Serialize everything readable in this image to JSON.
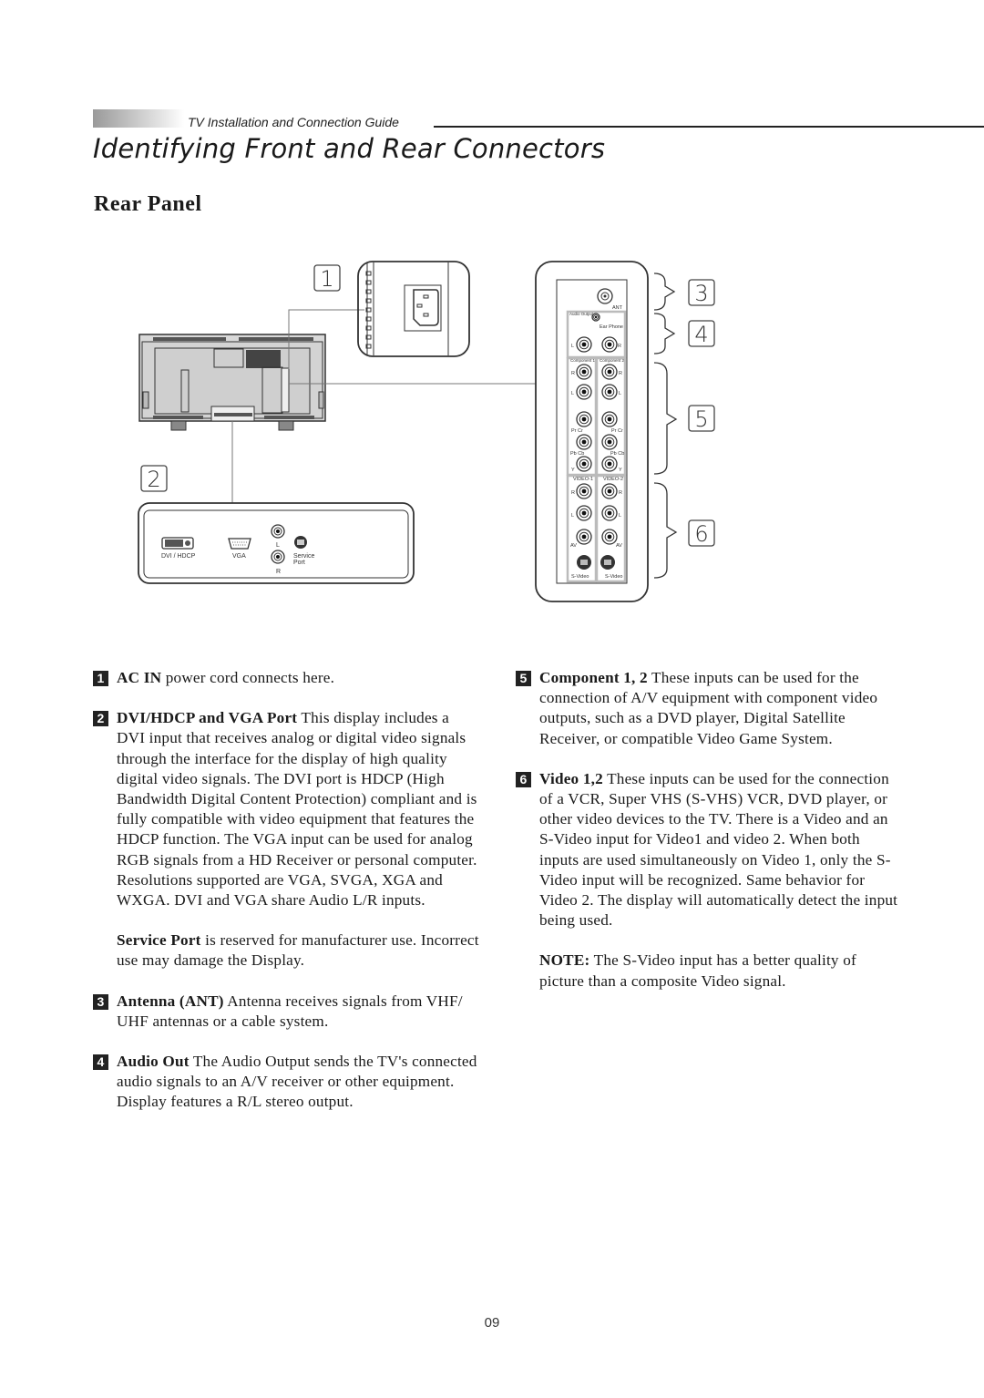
{
  "header": {
    "guide_title": "TV Installation and Connection Guide",
    "page_title": "Identifying Front and Rear Connectors",
    "section_title": "Rear Panel"
  },
  "diagram": {
    "callouts": [
      "1",
      "2",
      "3",
      "4",
      "5",
      "6"
    ],
    "bottom_panel_labels": {
      "dvi": "DVI / HDCP",
      "vga": "VGA",
      "audio_l": "L",
      "audio_r": "R",
      "service_line1": "Service",
      "service_line2": "Port"
    },
    "side_panel_labels": {
      "ant": "ANT",
      "audio_output": "Audio Output",
      "ear_phone": "Ear Phone",
      "L": "L",
      "R": "R",
      "component1": "Component 1",
      "component2": "Component 2",
      "pr_cr": "Pr  Cr",
      "pb_cb": "Pb  Cb",
      "Y": "Y",
      "video1": "VIDEO-1",
      "video2": "VIDEO-2",
      "av": "AV",
      "svideo": "S-Video"
    }
  },
  "left_column": {
    "items": [
      {
        "num": "1",
        "lead": "AC IN",
        "text": " power cord connects here."
      },
      {
        "num": "2",
        "lead": "DVI/HDCP and VGA Port",
        "text": "  This display includes a DVI input that receives analog or digital video signals through the interface  for the display of high quality digital video signals. The DVI port is HDCP  (High Bandwidth Digital Content Protection) compliant and is fully compatible with video equipment that features the HDCP function. The VGA input can be used for analog RGB signals from a HD Receiver or personal computer. Resolutions supported are VGA, SVGA, XGA and WXGA. DVI and VGA share Audio L/R inputs."
      },
      {
        "num": "",
        "lead": "Service Port",
        "text": "  is reserved for manufacturer use. Incorrect use may damage the Display."
      },
      {
        "num": "3",
        "lead": "Antenna (ANT)",
        "text": "  Antenna receives signals from VHF/ UHF antennas or a cable system."
      },
      {
        "num": "4",
        "lead": "Audio Out",
        "text": "  The Audio Output sends the TV's connected audio signals to an A/V receiver or other equipment. Display features a R/L stereo output."
      }
    ]
  },
  "right_column": {
    "items": [
      {
        "num": "5",
        "lead": "Component 1, 2",
        "text": "  These inputs can be used for the connection of A/V equipment with component video outputs, such as a DVD player, Digital Satellite Receiver, or compatible Video Game System."
      },
      {
        "num": "6",
        "lead": "Video 1,2",
        "text": "  These inputs can be used for the connection of a VCR, Super VHS (S-VHS) VCR, DVD player, or other video devices to the TV. There is a Video and an S-Video input for Video1 and video 2. When both inputs are used simultaneously  on Video 1, only the S-Video input will be recognized.  Same behavior for Video 2.  The display will automatically detect the input being used."
      },
      {
        "num": "",
        "lead": "NOTE:",
        "text": " The S-Video input has a better quality of picture than a composite Video signal."
      }
    ]
  },
  "footer": {
    "page_number": "09"
  }
}
